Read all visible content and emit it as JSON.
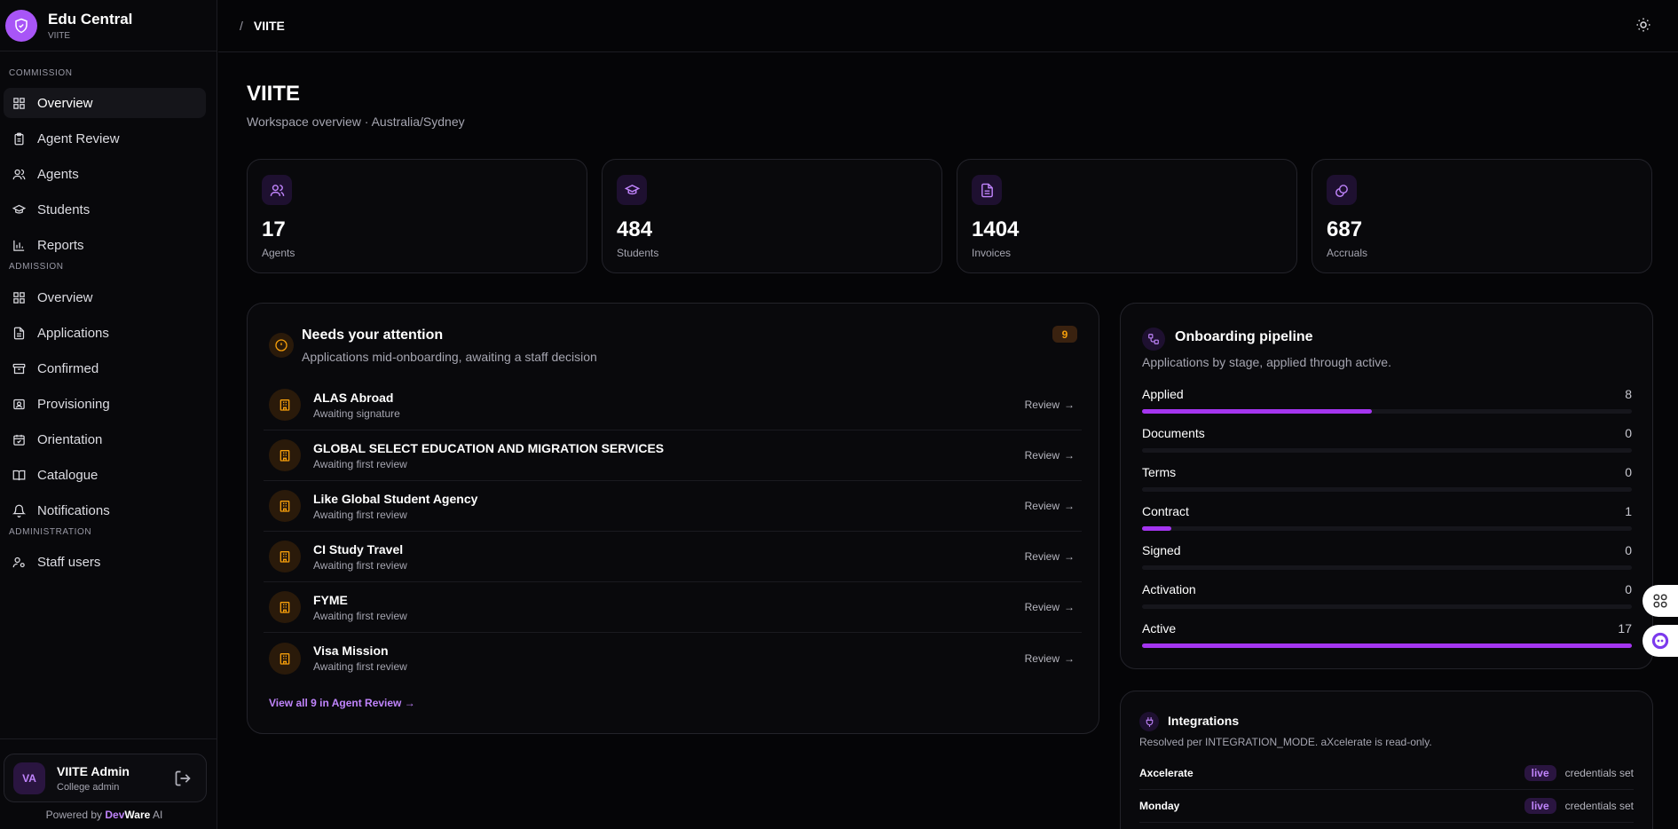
{
  "brand": {
    "title": "Edu Central",
    "subtitle": "VIITE"
  },
  "sidebar": {
    "sections": [
      {
        "label": "COMMISSION"
      },
      {
        "label": "ADMISSION"
      },
      {
        "label": "ADMINISTRATION"
      }
    ],
    "items": [
      {
        "label": "Overview",
        "icon": "grid-icon",
        "active": true
      },
      {
        "label": "Agent Review",
        "icon": "clipboard-icon"
      },
      {
        "label": "Agents",
        "icon": "users-icon"
      },
      {
        "label": "Students",
        "icon": "graduation-cap-icon"
      },
      {
        "label": "Reports",
        "icon": "bar-chart-icon"
      },
      {
        "label": "Overview",
        "icon": "grid-icon"
      },
      {
        "label": "Applications",
        "icon": "file-icon"
      },
      {
        "label": "Confirmed",
        "icon": "archive-icon"
      },
      {
        "label": "Provisioning",
        "icon": "id-card-icon"
      },
      {
        "label": "Orientation",
        "icon": "calendar-check-icon"
      },
      {
        "label": "Catalogue",
        "icon": "book-icon"
      },
      {
        "label": "Notifications",
        "icon": "bell-icon"
      },
      {
        "label": "Staff users",
        "icon": "user-cog-icon"
      }
    ],
    "user": {
      "initials": "VA",
      "name": "VIITE Admin",
      "role": "College admin"
    },
    "powered": {
      "prefix": "Powered by ",
      "brand1": "Dev",
      "brand2": "Ware",
      "suffix": " AI"
    }
  },
  "topbar": {
    "separator": "/",
    "crumb": "VIITE"
  },
  "page": {
    "title": "VIITE",
    "subtitle": "Workspace overview · Australia/Sydney"
  },
  "stats": [
    {
      "value": "17",
      "label": "Agents",
      "icon": "users-icon"
    },
    {
      "value": "484",
      "label": "Students",
      "icon": "graduation-cap-icon"
    },
    {
      "value": "1404",
      "label": "Invoices",
      "icon": "file-text-icon"
    },
    {
      "value": "687",
      "label": "Accruals",
      "icon": "coins-icon"
    }
  ],
  "attention": {
    "title": "Needs your attention",
    "subtitle": "Applications mid-onboarding, awaiting a staff decision",
    "badge": "9",
    "review_label": "Review",
    "rows": [
      {
        "name": "ALAS Abroad",
        "status": "Awaiting signature"
      },
      {
        "name": "GLOBAL SELECT EDUCATION AND MIGRATION SERVICES",
        "status": "Awaiting first review"
      },
      {
        "name": "Like Global Student Agency",
        "status": "Awaiting first review"
      },
      {
        "name": "CI Study Travel",
        "status": "Awaiting first review"
      },
      {
        "name": "FYME",
        "status": "Awaiting first review"
      },
      {
        "name": "Visa Mission",
        "status": "Awaiting first review"
      }
    ],
    "view_all": "View all 9 in Agent Review"
  },
  "pipeline": {
    "title": "Onboarding pipeline",
    "subtitle": "Applications by stage, applied through active.",
    "max": 17,
    "stages": [
      {
        "label": "Applied",
        "count": "8",
        "fraction": 0.47
      },
      {
        "label": "Documents",
        "count": "0",
        "fraction": 0
      },
      {
        "label": "Terms",
        "count": "0",
        "fraction": 0
      },
      {
        "label": "Contract",
        "count": "1",
        "fraction": 0.059
      },
      {
        "label": "Signed",
        "count": "0",
        "fraction": 0
      },
      {
        "label": "Activation",
        "count": "0",
        "fraction": 0
      },
      {
        "label": "Active",
        "count": "17",
        "fraction": 1
      }
    ]
  },
  "integrations": {
    "title": "Integrations",
    "subtitle": "Resolved per INTEGRATION_MODE. aXcelerate is read-only.",
    "rows": [
      {
        "name": "Axcelerate",
        "status": "live",
        "note": "credentials set"
      },
      {
        "name": "Monday",
        "status": "live",
        "note": "credentials set"
      }
    ]
  },
  "colors": {
    "accent": "#a855f7",
    "warning": "#f59e0b",
    "background": "#050507"
  }
}
